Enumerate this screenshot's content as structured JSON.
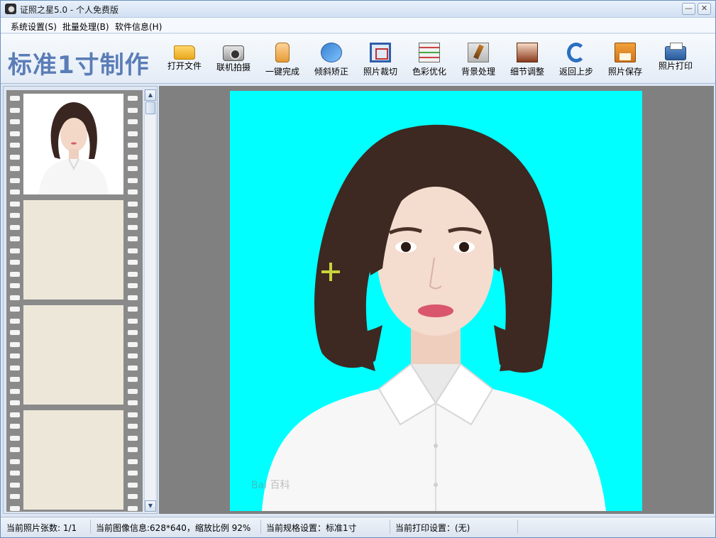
{
  "window": {
    "title": "证照之星5.0 - 个人免费版",
    "minimize_glyph": "—",
    "close_glyph": "✕"
  },
  "menu": {
    "items": [
      {
        "label": "系统设置(S)"
      },
      {
        "label": "批量处理(B)"
      },
      {
        "label": "软件信息(H)"
      }
    ]
  },
  "toolbar": {
    "brand": "标准1寸制作",
    "tools": [
      {
        "label": "打开文件",
        "icon": "folder-icon"
      },
      {
        "label": "联机拍摄",
        "icon": "camera-icon"
      },
      {
        "label": "一键完成",
        "icon": "hand-pointer-icon"
      },
      {
        "label": "倾斜矫正",
        "icon": "rotate-icon"
      },
      {
        "label": "照片裁切",
        "icon": "crop-icon"
      },
      {
        "label": "色彩优化",
        "icon": "color-adjust-icon"
      },
      {
        "label": "背景处理",
        "icon": "brush-icon"
      },
      {
        "label": "细节调整",
        "icon": "histogram-icon"
      },
      {
        "label": "返回上步",
        "icon": "undo-icon"
      },
      {
        "label": "照片保存",
        "icon": "save-icon"
      },
      {
        "label": "照片打印",
        "icon": "printer-icon"
      }
    ]
  },
  "filmstrip": {
    "up_glyph": "▲",
    "down_glyph": "▼"
  },
  "viewer": {
    "background_color": "#00ffff",
    "watermark": "Bai 百科"
  },
  "status": {
    "photo_count": "当前照片张数: 1/1",
    "image_info": "当前图像信息:628*640，缩放比例 92%",
    "spec_setting": "当前规格设置：标准1寸",
    "print_setting": "当前打印设置：(无)"
  },
  "colors": {
    "accent": "#5a7db7",
    "photo_background": "#00ffff",
    "viewer_background": "#808080"
  }
}
